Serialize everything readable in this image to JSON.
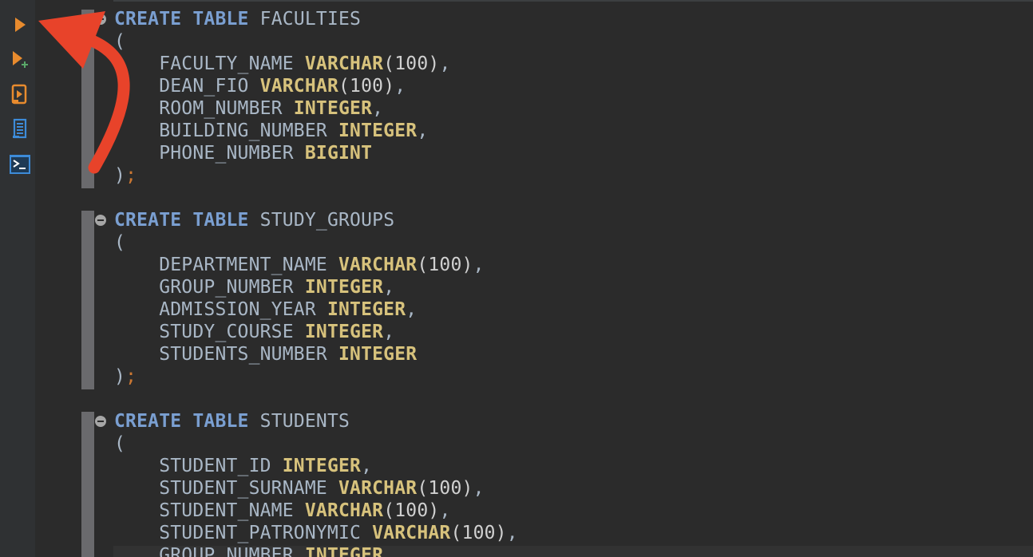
{
  "toolbar": {
    "buttons": [
      {
        "name": "execute",
        "icon": "run-icon",
        "color": "#e88b2e"
      },
      {
        "name": "execute-new-tab",
        "icon": "run-plus-icon",
        "color": "#e88b2e"
      },
      {
        "name": "execute-script",
        "icon": "script-run-icon",
        "color": "#e88b2e"
      },
      {
        "name": "explain-plan",
        "icon": "document-list-icon",
        "color": "#3d8bd8"
      },
      {
        "name": "console",
        "icon": "terminal-icon",
        "color": "#3d8bd8"
      }
    ]
  },
  "editor": {
    "blocks": [
      {
        "kw_create": "CREATE",
        "kw_table": "TABLE",
        "table_name": "FACULTIES",
        "open": "(",
        "columns": [
          {
            "name": "FACULTY_NAME",
            "type": "VARCHAR",
            "args": "(100)",
            "sep": ","
          },
          {
            "name": "DEAN_FIO",
            "type": "VARCHAR",
            "args": "(100)",
            "sep": ","
          },
          {
            "name": "ROOM_NUMBER",
            "type": "INTEGER",
            "args": "",
            "sep": ","
          },
          {
            "name": "BUILDING_NUMBER",
            "type": "INTEGER",
            "args": "",
            "sep": ","
          },
          {
            "name": "PHONE_NUMBER",
            "type": "BIGINT",
            "args": "",
            "sep": ""
          }
        ],
        "close": ")",
        "semicolon": ";"
      },
      {
        "kw_create": "CREATE",
        "kw_table": "TABLE",
        "table_name": "STUDY_GROUPS",
        "open": "(",
        "columns": [
          {
            "name": "DEPARTMENT_NAME",
            "type": "VARCHAR",
            "args": "(100)",
            "sep": ","
          },
          {
            "name": "GROUP_NUMBER",
            "type": "INTEGER",
            "args": "",
            "sep": ","
          },
          {
            "name": "ADMISSION_YEAR",
            "type": "INTEGER",
            "args": "",
            "sep": ","
          },
          {
            "name": "STUDY_COURSE",
            "type": "INTEGER",
            "args": "",
            "sep": ","
          },
          {
            "name": "STUDENTS_NUMBER",
            "type": "INTEGER",
            "args": "",
            "sep": ""
          }
        ],
        "close": ")",
        "semicolon": ";"
      },
      {
        "kw_create": "CREATE",
        "kw_table": "TABLE",
        "table_name": "STUDENTS",
        "open": "(",
        "columns": [
          {
            "name": "STUDENT_ID",
            "type": "INTEGER",
            "args": "",
            "sep": ","
          },
          {
            "name": "STUDENT_SURNAME",
            "type": "VARCHAR",
            "args": "(100)",
            "sep": ","
          },
          {
            "name": "STUDENT_NAME",
            "type": "VARCHAR",
            "args": "(100)",
            "sep": ","
          },
          {
            "name": "STUDENT_PATRONYMIC",
            "type": "VARCHAR",
            "args": "(100)",
            "sep": ","
          },
          {
            "name": "GROUP_NUMBER",
            "type": "INTEGER",
            "args": "",
            "sep": ","
          }
        ],
        "close": "",
        "semicolon": ""
      }
    ]
  },
  "annotation": {
    "color": "#e8432a",
    "icon": "curved-arrow-icon"
  }
}
